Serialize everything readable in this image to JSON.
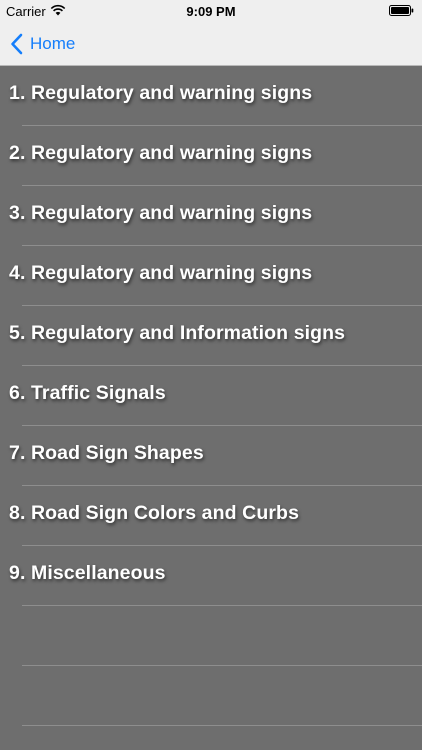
{
  "status_bar": {
    "carrier": "Carrier",
    "time": "9:09 PM",
    "wifi_icon": "wifi-icon",
    "battery_icon": "battery-icon"
  },
  "nav": {
    "back_label": "Home",
    "back_icon": "chevron-left-icon",
    "accent_color": "#157efb"
  },
  "list": {
    "background_color": "#6e6e6e",
    "items": [
      {
        "label": "1. Regulatory and warning signs"
      },
      {
        "label": "2. Regulatory and warning signs"
      },
      {
        "label": "3. Regulatory and warning signs"
      },
      {
        "label": "4. Regulatory and warning signs"
      },
      {
        "label": "5. Regulatory and Information signs"
      },
      {
        "label": "6. Traffic Signals"
      },
      {
        "label": "7. Road Sign Shapes"
      },
      {
        "label": "8. Road Sign Colors and Curbs"
      },
      {
        "label": "9. Miscellaneous"
      }
    ]
  }
}
